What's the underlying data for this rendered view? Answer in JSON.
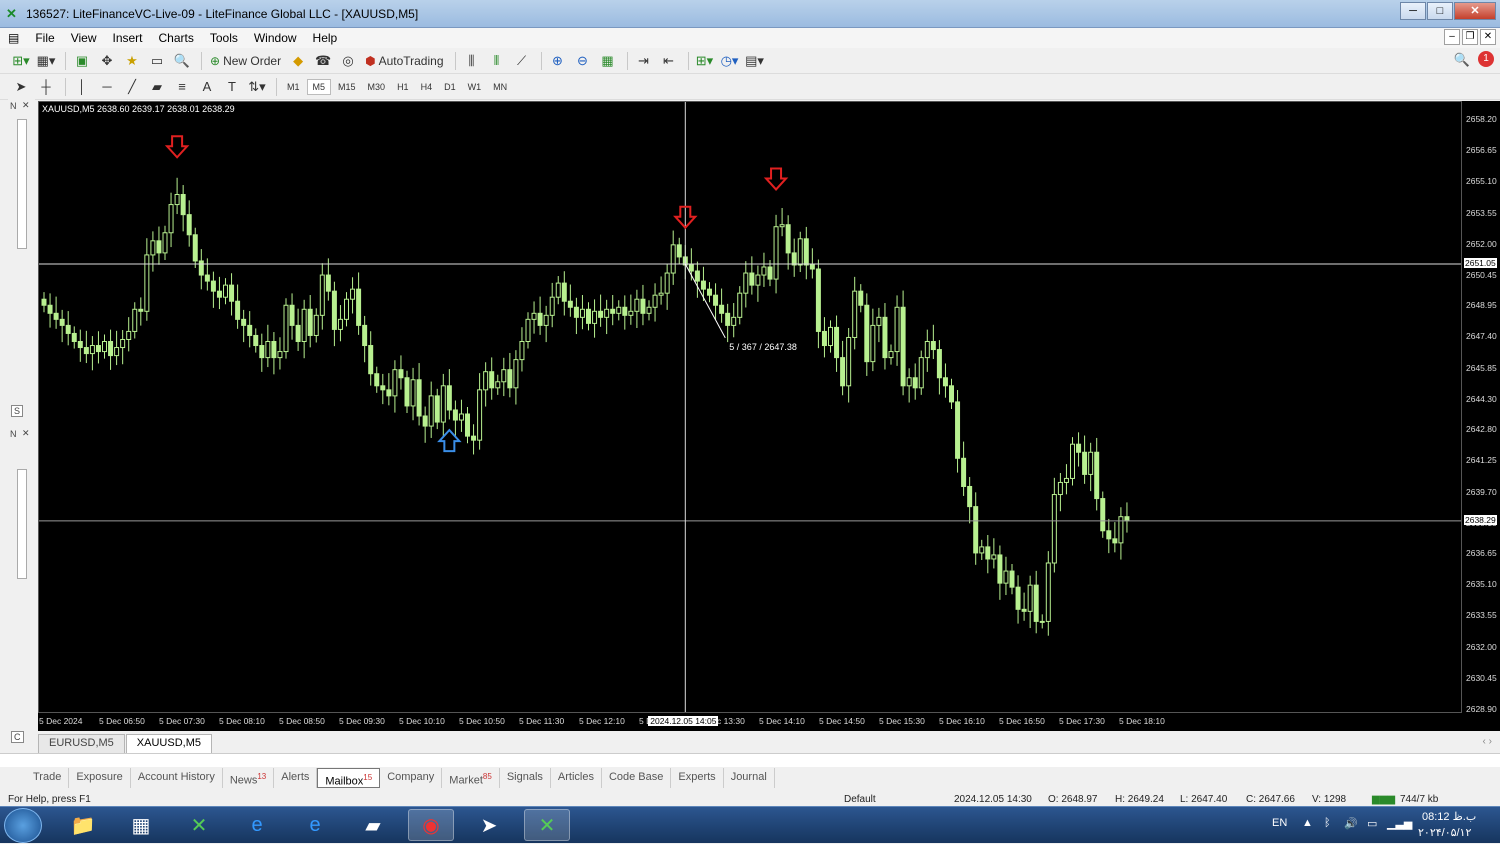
{
  "window": {
    "title": "136527: LiteFinanceVC-Live-09 - LiteFinance Global LLC - [XAUUSD,M5]"
  },
  "menu": [
    "File",
    "View",
    "Insert",
    "Charts",
    "Tools",
    "Window",
    "Help"
  ],
  "toolbar": {
    "new_order": "New Order",
    "autotrading": "AutoTrading"
  },
  "timeframes": [
    "M1",
    "M5",
    "M15",
    "M30",
    "H1",
    "H4",
    "D1",
    "W1",
    "MN"
  ],
  "active_timeframe": "M5",
  "left_panel": {
    "tab1": "N",
    "tab2": "S",
    "tab3": "N",
    "tab4": "C"
  },
  "chart": {
    "info": "XAUUSD,M5  2638.60 2639.17 2638.01 2638.29",
    "crosshair_label": "5 / 367 / 2647.38",
    "crosshair_price": "2651.05",
    "bid_price": "2638.29",
    "crosshair_time": "2024.12.05 14:05",
    "y_labels": [
      "2658.20",
      "2656.65",
      "2655.10",
      "2653.55",
      "2652.00",
      "2650.45",
      "2648.95",
      "2647.40",
      "2645.85",
      "2644.30",
      "2642.80",
      "2641.25",
      "2639.70",
      "2638.15",
      "2636.65",
      "2635.10",
      "2633.55",
      "2632.00",
      "2630.45",
      "2628.90"
    ],
    "x_labels": [
      "5 Dec 2024",
      "5 Dec 06:50",
      "5 Dec 07:30",
      "5 Dec 08:10",
      "5 Dec 08:50",
      "5 Dec 09:30",
      "5 Dec 10:10",
      "5 Dec 10:50",
      "5 Dec 11:30",
      "5 Dec 12:10",
      "5 Dec 12:50",
      "5 Dec 13:30",
      "5 Dec 14:10",
      "5 Dec 14:50",
      "5 Dec 15:30",
      "5 Dec 16:10",
      "5 Dec 16:50",
      "5 Dec 17:30",
      "5 Dec 18:10"
    ],
    "candle_color": "#b8f090",
    "down_arrow_color": "#e02020",
    "up_arrow_color": "#3a8ee8"
  },
  "chart_data": {
    "type": "candlestick",
    "symbol": "XAUUSD",
    "timeframe": "M5",
    "ylim": [
      2628.9,
      2658.2
    ],
    "closes": [
      2649.0,
      2648.6,
      2648.3,
      2648.0,
      2647.6,
      2647.2,
      2646.9,
      2646.6,
      2647.0,
      2646.7,
      2647.2,
      2646.5,
      2646.9,
      2647.3,
      2647.7,
      2648.8,
      2648.7,
      2651.5,
      2652.2,
      2651.6,
      2652.6,
      2654.0,
      2654.5,
      2653.5,
      2652.5,
      2651.2,
      2650.5,
      2650.2,
      2649.7,
      2649.4,
      2650.0,
      2649.2,
      2648.3,
      2648.0,
      2647.5,
      2647.0,
      2646.4,
      2647.2,
      2646.4,
      2646.7,
      2649.0,
      2648.0,
      2647.2,
      2648.8,
      2647.5,
      2648.5,
      2650.5,
      2649.7,
      2647.8,
      2648.3,
      2649.3,
      2649.8,
      2648.0,
      2647.0,
      2645.6,
      2645.0,
      2644.8,
      2644.5,
      2645.8,
      2645.4,
      2644.0,
      2645.3,
      2643.5,
      2643.0,
      2644.5,
      2643.2,
      2645.0,
      2643.8,
      2643.3,
      2643.6,
      2642.5,
      2642.3,
      2644.8,
      2645.7,
      2644.9,
      2645.2,
      2645.8,
      2644.9,
      2646.3,
      2647.2,
      2648.3,
      2648.6,
      2648.0,
      2648.5,
      2649.4,
      2650.1,
      2649.2,
      2648.9,
      2648.4,
      2648.8,
      2648.1,
      2648.7,
      2648.4,
      2648.8,
      2648.6,
      2648.9,
      2648.5,
      2648.7,
      2649.3,
      2648.6,
      2648.9,
      2649.5,
      2649.6,
      2650.6,
      2652.0,
      2651.4,
      2651.0,
      2650.7,
      2650.2,
      2649.8,
      2649.5,
      2649.0,
      2648.6,
      2648.0,
      2648.4,
      2649.6,
      2650.6,
      2650.0,
      2650.5,
      2650.9,
      2650.3,
      2652.9,
      2653.0,
      2651.6,
      2651.0,
      2652.3,
      2651.0,
      2650.8,
      2647.7,
      2647.0,
      2647.9,
      2646.4,
      2645.0,
      2647.4,
      2649.7,
      2649.0,
      2646.2,
      2648.0,
      2648.4,
      2646.4,
      2646.7,
      2648.9,
      2645.0,
      2645.4,
      2644.9,
      2646.4,
      2647.2,
      2646.8,
      2645.4,
      2645.0,
      2644.2,
      2641.4,
      2640.0,
      2639.0,
      2636.7,
      2637.0,
      2636.4,
      2636.6,
      2635.2,
      2635.8,
      2635.0,
      2633.9,
      2633.8,
      2635.1,
      2633.3,
      2633.3,
      2636.2,
      2639.6,
      2640.2,
      2640.4,
      2642.1,
      2641.7,
      2640.6,
      2641.7,
      2639.4,
      2637.8,
      2637.4,
      2637.2,
      2638.5,
      2638.3
    ],
    "annotations": [
      {
        "type": "down-arrow",
        "candle": 22
      },
      {
        "type": "up-arrow",
        "candle": 67
      },
      {
        "type": "down-arrow",
        "candle": 106
      },
      {
        "type": "down-arrow",
        "candle": 121
      }
    ]
  },
  "chart_tabs": [
    "EURUSD,M5",
    "XAUUSD,M5"
  ],
  "active_chart_tab": "XAUUSD,M5",
  "terminal_tabs": [
    {
      "label": "Trade",
      "badge": ""
    },
    {
      "label": "Exposure",
      "badge": ""
    },
    {
      "label": "Account History",
      "badge": ""
    },
    {
      "label": "News",
      "badge": "13"
    },
    {
      "label": "Alerts",
      "badge": ""
    },
    {
      "label": "Mailbox",
      "badge": "15"
    },
    {
      "label": "Company",
      "badge": ""
    },
    {
      "label": "Market",
      "badge": "85"
    },
    {
      "label": "Signals",
      "badge": ""
    },
    {
      "label": "Articles",
      "badge": ""
    },
    {
      "label": "Code Base",
      "badge": ""
    },
    {
      "label": "Experts",
      "badge": ""
    },
    {
      "label": "Journal",
      "badge": ""
    }
  ],
  "active_terminal_tab": "Mailbox",
  "status": {
    "help": "For Help, press F1",
    "profile": "Default",
    "time": "2024.12.05 14:30",
    "open": "O: 2648.97",
    "high": "H: 2649.24",
    "low": "L: 2647.40",
    "close": "C: 2647.66",
    "volume": "V: 1298",
    "traffic": "744/7 kb"
  },
  "tray": {
    "lang": "EN",
    "time": "08:12 ب.ظ",
    "date": "۲۰۲۴/۰۵/۱۲"
  }
}
